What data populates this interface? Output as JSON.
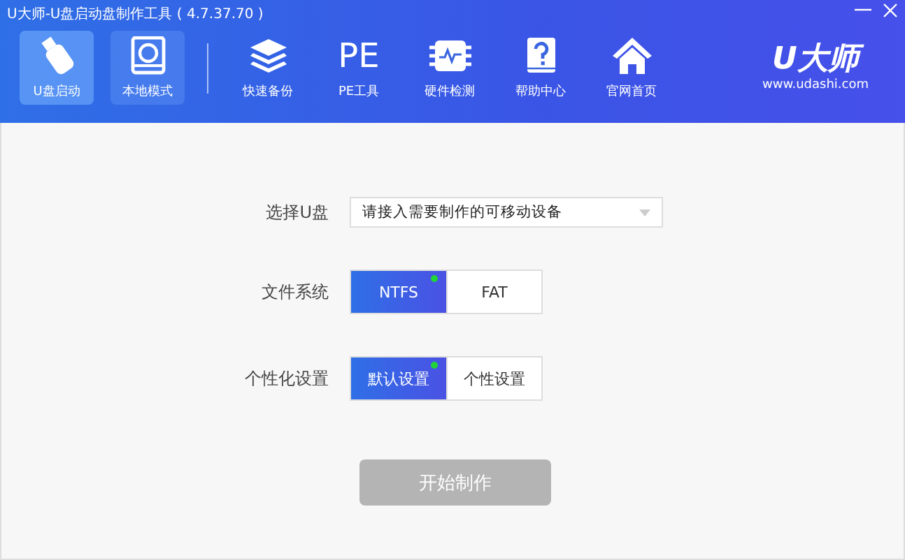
{
  "window": {
    "title": "U大师-U盘启动盘制作工具 ( 4.7.37.70 )"
  },
  "nav": [
    {
      "label": "U盘启动",
      "kind": "usb",
      "selected": true,
      "hovered": false
    },
    {
      "label": "本地模式",
      "kind": "disk",
      "selected": false,
      "hovered": true
    },
    {
      "label": "快速备份",
      "kind": "layers",
      "selected": false,
      "hovered": false,
      "separator_before": true
    },
    {
      "label": "PE工具",
      "kind": "text",
      "glyph": "PE",
      "selected": false,
      "hovered": false
    },
    {
      "label": "硬件检测",
      "kind": "chip",
      "selected": false,
      "hovered": false
    },
    {
      "label": "帮助中心",
      "kind": "help",
      "selected": false,
      "hovered": false
    },
    {
      "label": "官网首页",
      "kind": "home",
      "selected": false,
      "hovered": false
    }
  ],
  "logo": {
    "brand": "U大师",
    "url": "www.udashi.com"
  },
  "form": {
    "device": {
      "label": "选择U盘",
      "placeholder": "请接入需要制作的可移动设备"
    },
    "groups": [
      {
        "label": "文件系统",
        "options": [
          {
            "label": "NTFS",
            "selected": true
          },
          {
            "label": "FAT",
            "selected": false
          }
        ]
      },
      {
        "label": "个性化设置",
        "options": [
          {
            "label": "默认设置",
            "selected": true
          },
          {
            "label": "个性设置",
            "selected": false
          }
        ]
      }
    ],
    "start": {
      "label": "开始制作",
      "disabled": true
    }
  }
}
